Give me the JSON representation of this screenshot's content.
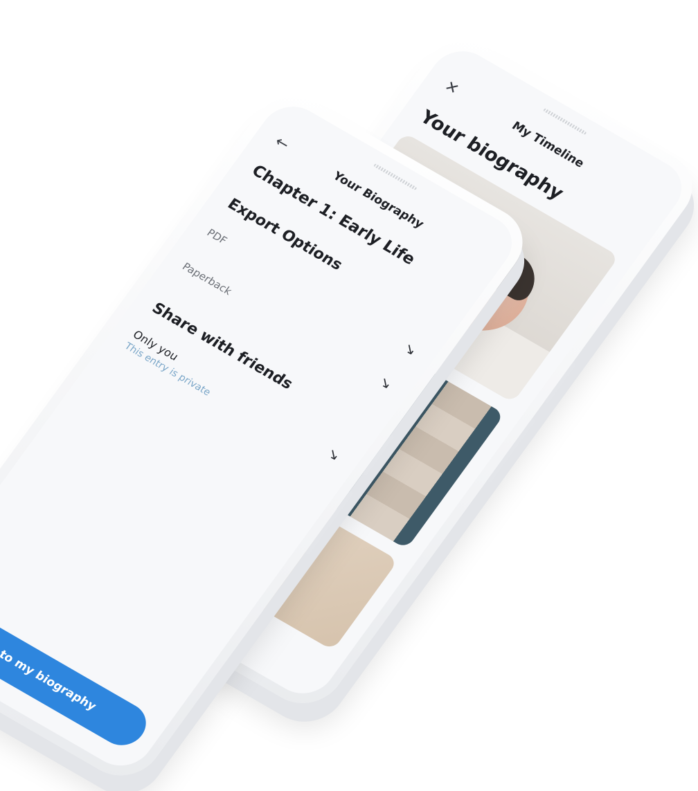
{
  "timeline_screen": {
    "close_icon": "close-icon",
    "title": "My Timeline",
    "heading": "Your biography"
  },
  "biography_screen": {
    "back_icon": "arrow-left-icon",
    "title": "Your Biography",
    "chapter": "Chapter 1: Early Life",
    "export_heading": "Export Options",
    "export_options": [
      {
        "label": "PDF",
        "icon": "arrow-down-right-icon"
      },
      {
        "label": "Paperback",
        "icon": "arrow-down-right-icon"
      }
    ],
    "share_heading": "Share with friends",
    "share_value": "Only you",
    "share_note": "This entry is private",
    "share_icon": "arrow-down-right-icon",
    "cta_label": "Add to my biography",
    "accent_color": "#2e86de"
  }
}
